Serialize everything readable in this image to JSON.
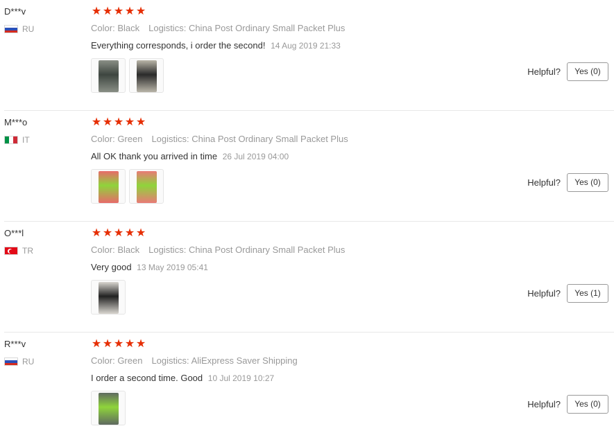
{
  "labels": {
    "color_prefix": "Color:",
    "logistics_prefix": "Logistics:",
    "helpful": "Helpful?"
  },
  "reviews": [
    {
      "user": "D***v",
      "country": "RU",
      "flag": "ru",
      "rating": 5,
      "color": "Black",
      "logistics": "China Post Ordinary Small Packet Plus",
      "text": "Everything corresponds, i order the second!",
      "date": "14 Aug 2019 21:33",
      "photos": [
        {
          "name": "review-photo-1",
          "fg": "#3e4640",
          "bg": "#8a8f86"
        },
        {
          "name": "review-photo-2",
          "fg": "#2a2a2a",
          "bg": "#b9b5a8"
        }
      ],
      "yes_label": "Yes (0)"
    },
    {
      "user": "M***o",
      "country": "IT",
      "flag": "it",
      "rating": 5,
      "color": "Green",
      "logistics": "China Post Ordinary Small Packet Plus",
      "text": "All OK thank you arrived in time",
      "date": "26 Jul 2019 04:00",
      "photos": [
        {
          "name": "review-photo-1",
          "fg": "#8fd43b",
          "bg": "#e86a6a"
        },
        {
          "name": "review-photo-2",
          "fg": "#8fd43b",
          "bg": "#e97a76"
        }
      ],
      "yes_label": "Yes (0)"
    },
    {
      "user": "O***l",
      "country": "TR",
      "flag": "tr",
      "rating": 5,
      "color": "Black",
      "logistics": "China Post Ordinary Small Packet Plus",
      "text": "Very good",
      "date": "13 May 2019 05:41",
      "photos": [
        {
          "name": "review-photo-1",
          "fg": "#222222",
          "bg": "#d9d6d0"
        }
      ],
      "yes_label": "Yes (1)"
    },
    {
      "user": "R***v",
      "country": "RU",
      "flag": "ru",
      "rating": 5,
      "color": "Green",
      "logistics": "AliExpress Saver Shipping",
      "text": "I order a second time. Good",
      "date": "10 Jul 2019 10:27",
      "photos": [
        {
          "name": "review-photo-1",
          "fg": "#8fd43b",
          "bg": "#5f6a60"
        }
      ],
      "yes_label": "Yes (0)"
    }
  ]
}
